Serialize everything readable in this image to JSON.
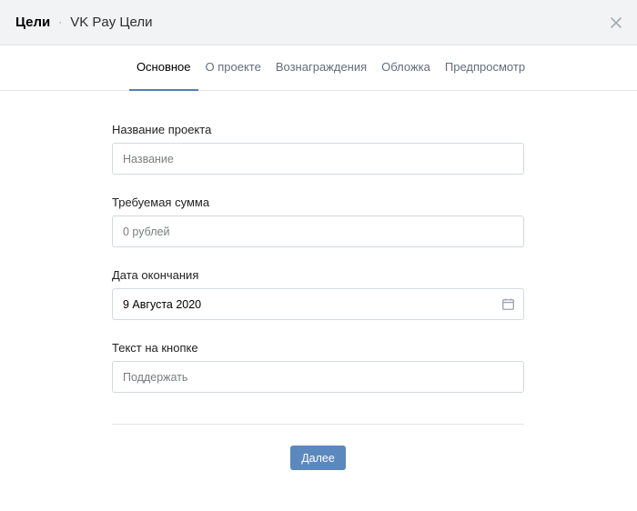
{
  "header": {
    "root": "Цели",
    "separator": "·",
    "current": "VK Pay Цели"
  },
  "tabs": [
    {
      "label": "Основное",
      "active": true
    },
    {
      "label": "О проекте",
      "active": false
    },
    {
      "label": "Вознаграждения",
      "active": false
    },
    {
      "label": "Обложка",
      "active": false
    },
    {
      "label": "Предпросмотр",
      "active": false
    }
  ],
  "form": {
    "name": {
      "label": "Название проекта",
      "placeholder": "Название",
      "value": ""
    },
    "amount": {
      "label": "Требуемая сумма",
      "placeholder": "0 рублей",
      "value": ""
    },
    "end_date": {
      "label": "Дата окончания",
      "value": "9 Августа 2020"
    },
    "button_text": {
      "label": "Текст на кнопке",
      "placeholder": "Поддержать",
      "value": ""
    }
  },
  "actions": {
    "next_label": "Далее"
  },
  "icons": {
    "close": "close-icon",
    "calendar": "calendar-icon"
  },
  "colors": {
    "accent": "#5181b8",
    "button": "#5b88bd",
    "header_bg": "#f2f3f5"
  }
}
